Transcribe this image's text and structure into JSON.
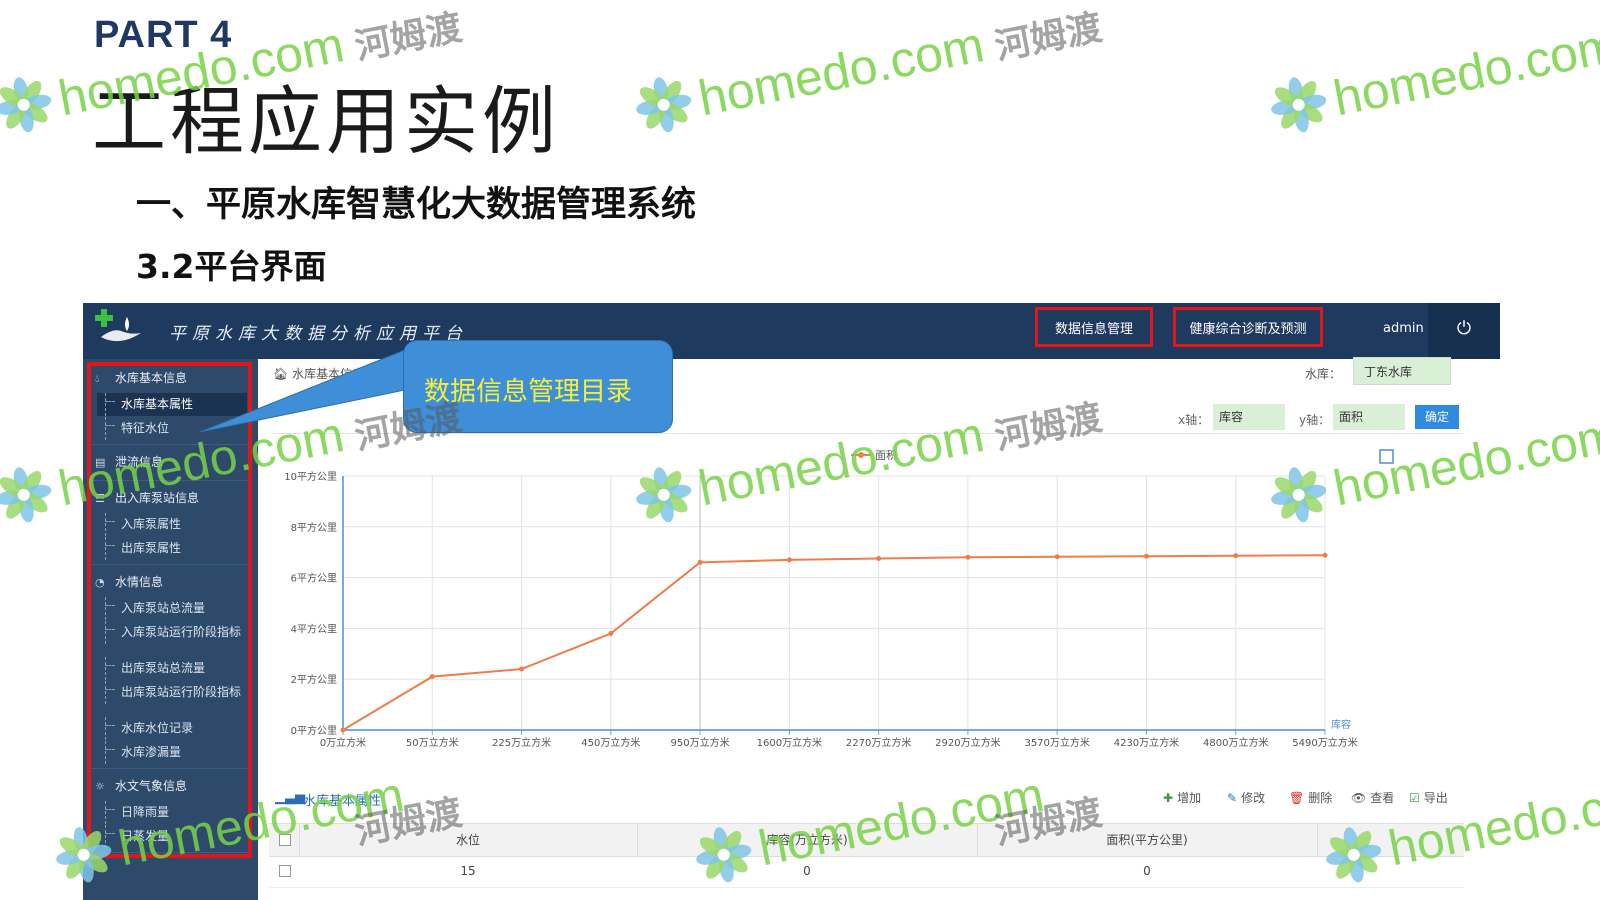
{
  "slide": {
    "part_label": "PART 4",
    "title": "工程应用实例",
    "section_title": "一、平原水库智慧化大数据管理系统",
    "sub_title": "3.2平台界面"
  },
  "app": {
    "title": "平原水库大数据分析应用平台",
    "nav": {
      "data_mgmt": "数据信息管理",
      "health": "健康综合诊断及预测",
      "user": "admin",
      "power_icon": "power-icon"
    },
    "sidebar": {
      "groups": [
        {
          "label": "水库基本信息",
          "icon": "drop-icon",
          "items": [
            "水库基本属性",
            "特征水位"
          ]
        },
        {
          "label": "泄流信息",
          "icon": "clipboard-icon",
          "items": []
        },
        {
          "label": "出入库泵站信息",
          "icon": "list-icon",
          "items": [
            "入库泵属性",
            "出库泵属性"
          ]
        },
        {
          "label": "水情信息",
          "icon": "gauge-icon",
          "items": [
            "入库泵站总流量",
            "入库泵站运行阶段指标",
            "出库泵站总流量",
            "出库泵站运行阶段指标",
            "水库水位记录",
            "水库渗漏量"
          ]
        },
        {
          "label": "水文气象信息",
          "icon": "sun-icon",
          "items": [
            "日降雨量",
            "日蒸发量"
          ]
        }
      ],
      "active_item": "水库基本属性"
    },
    "breadcrumb": "水库基本信息  >  水",
    "reservoir_label": "水库：",
    "reservoir_value": "丁东水库",
    "x_axis_label": "x轴：",
    "x_axis_value": "库容",
    "y_axis_label": "y轴：",
    "y_axis_value": "面积",
    "confirm_label": "确定",
    "table": {
      "title": "水库基本属性",
      "tools": [
        "增加",
        "修改",
        "删除",
        "查看",
        "导出"
      ],
      "columns": [
        "水位",
        "库容(万立方米)",
        "面积(平方公里)"
      ],
      "rows": [
        [
          "15",
          "0",
          "0"
        ]
      ]
    }
  },
  "callout": "数据信息管理目录",
  "watermark": {
    "url": "homedo.com",
    "cn": "河姆渡"
  },
  "colors": {
    "series": "#f07c4a",
    "nav": "#1e3a5f",
    "sidebar": "#2e4a6b",
    "highlight": "#e0161b",
    "callout": "#3e8fd8"
  },
  "chart_data": {
    "type": "line",
    "legend": "面积",
    "x_axis_name": "库容",
    "categories": [
      "0万立方米",
      "50万立方米",
      "225万立方米",
      "450万立方米",
      "950万立方米",
      "1600万立方米",
      "2270万立方米",
      "2920万立方米",
      "3570万立方米",
      "4230万立方米",
      "4800万立方米",
      "5490万立方米"
    ],
    "values": [
      0,
      2.1,
      2.4,
      3.8,
      6.6,
      6.7,
      6.75,
      6.8,
      6.82,
      6.84,
      6.86,
      6.88
    ],
    "y_ticks": [
      "0平方公里",
      "2平方公里",
      "4平方公里",
      "6平方公里",
      "8平方公里",
      "10平方公里"
    ],
    "ylim": [
      0,
      10
    ],
    "grid": true
  }
}
